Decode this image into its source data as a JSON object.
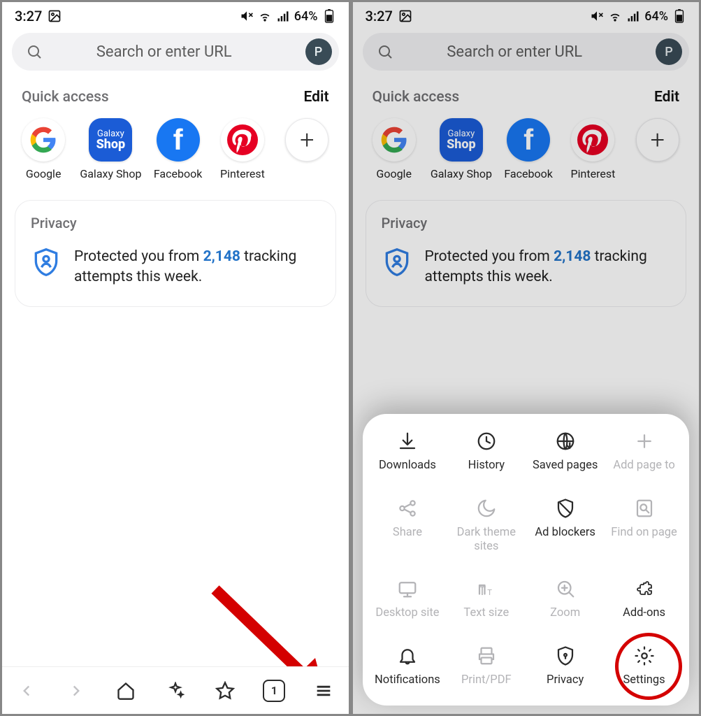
{
  "status": {
    "time": "3:27",
    "battery": "64%"
  },
  "search": {
    "placeholder": "Search or enter URL",
    "avatar_initial": "P"
  },
  "quick_access": {
    "title": "Quick access",
    "edit": "Edit",
    "items": [
      {
        "label": "Google"
      },
      {
        "label": "Galaxy Shop"
      },
      {
        "label": "Facebook"
      },
      {
        "label": "Pinterest"
      }
    ]
  },
  "privacy": {
    "title": "Privacy",
    "text_before": "Protected you from ",
    "count": "2,148",
    "text_after": " tracking attempts this week."
  },
  "bottom_nav": {
    "tab_count": "1"
  },
  "menu": {
    "items": [
      {
        "label": "Downloads",
        "dimmed": false,
        "icon": "download"
      },
      {
        "label": "History",
        "dimmed": false,
        "icon": "history"
      },
      {
        "label": "Saved pages",
        "dimmed": false,
        "icon": "saved"
      },
      {
        "label": "Add page to",
        "dimmed": true,
        "icon": "plus"
      },
      {
        "label": "Share",
        "dimmed": true,
        "icon": "share"
      },
      {
        "label": "Dark theme sites",
        "dimmed": true,
        "icon": "moon"
      },
      {
        "label": "Ad blockers",
        "dimmed": false,
        "icon": "shield-slash"
      },
      {
        "label": "Find on page",
        "dimmed": true,
        "icon": "find"
      },
      {
        "label": "Desktop site",
        "dimmed": true,
        "icon": "desktop"
      },
      {
        "label": "Text size",
        "dimmed": true,
        "icon": "text-size"
      },
      {
        "label": "Zoom",
        "dimmed": true,
        "icon": "zoom"
      },
      {
        "label": "Add-ons",
        "dimmed": false,
        "icon": "puzzle"
      },
      {
        "label": "Notifications",
        "dimmed": false,
        "icon": "bell"
      },
      {
        "label": "Print/PDF",
        "dimmed": true,
        "icon": "print"
      },
      {
        "label": "Privacy",
        "dimmed": false,
        "icon": "privacy"
      },
      {
        "label": "Settings",
        "dimmed": false,
        "icon": "gear"
      }
    ]
  }
}
